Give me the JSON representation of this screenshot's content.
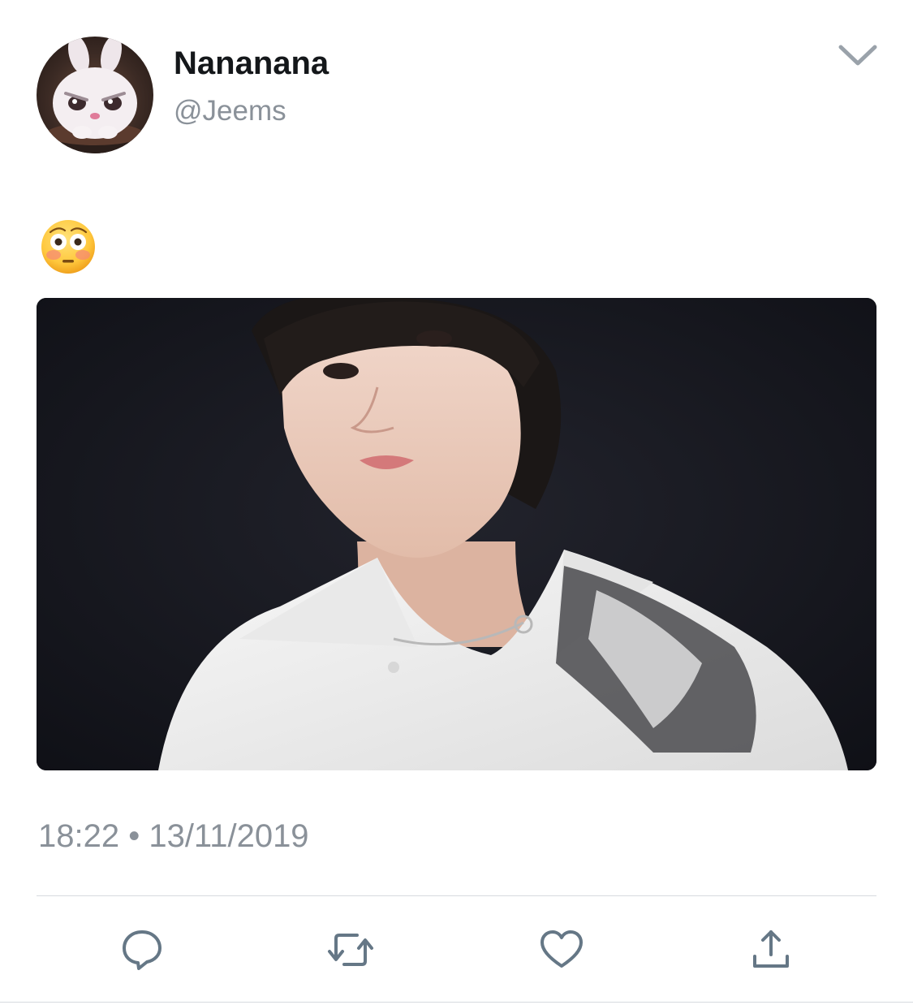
{
  "tweet": {
    "author": {
      "display_name": "Nananana",
      "handle": "@Jeems",
      "avatar": "avatar-image"
    },
    "text": "😳",
    "timestamp": "18:22 • 13/11/2019"
  },
  "icons": {
    "menu": "chevron-down-icon",
    "reply": "reply-icon",
    "retweet": "retweet-icon",
    "like": "heart-icon",
    "share": "share-icon"
  },
  "colors": {
    "text_primary": "#14171a",
    "text_secondary": "#8a9199",
    "icon": "#657786",
    "divider": "#d6dadf"
  }
}
